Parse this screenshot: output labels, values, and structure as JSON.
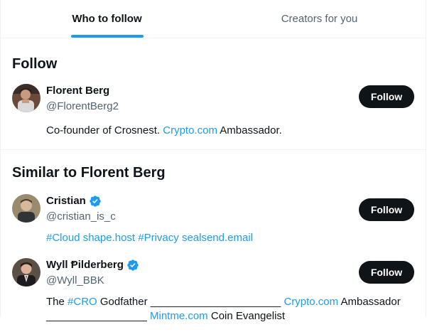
{
  "tabs": [
    {
      "label": "Who to follow"
    },
    {
      "label": "Creators for you"
    }
  ],
  "follow_section": {
    "title": "Follow",
    "user": {
      "name": "Florent Berg",
      "handle": "@FlorentBerg2",
      "bio_pre": "Co-founder of Crosnest. ",
      "bio_link": "Crypto.com",
      "bio_post": " Ambassador.",
      "button": "Follow"
    }
  },
  "similar_section": {
    "title": "Similar to Florent Berg",
    "users": [
      {
        "name": "Cristian",
        "handle": "@cristian_is_c",
        "bio": "#Cloud shape.host #Privacy sealsend.email",
        "button": "Follow",
        "verified": true
      },
      {
        "name": "Wyll Ᵽilderberg",
        "handle": "@Wyll_BBK",
        "bio_parts": [
          "The ",
          "#CRO",
          " Godfather ______________________ ",
          "Crypto.com",
          " Ambassador",
          "_________________ ",
          "Mintme.com",
          " Coin Evangelist"
        ],
        "button": "Follow",
        "verified": true
      }
    ]
  },
  "colors": {
    "accent": "#1d9bf0",
    "text": "#0f1419",
    "secondary": "#536471",
    "button_bg": "#0f1419"
  }
}
